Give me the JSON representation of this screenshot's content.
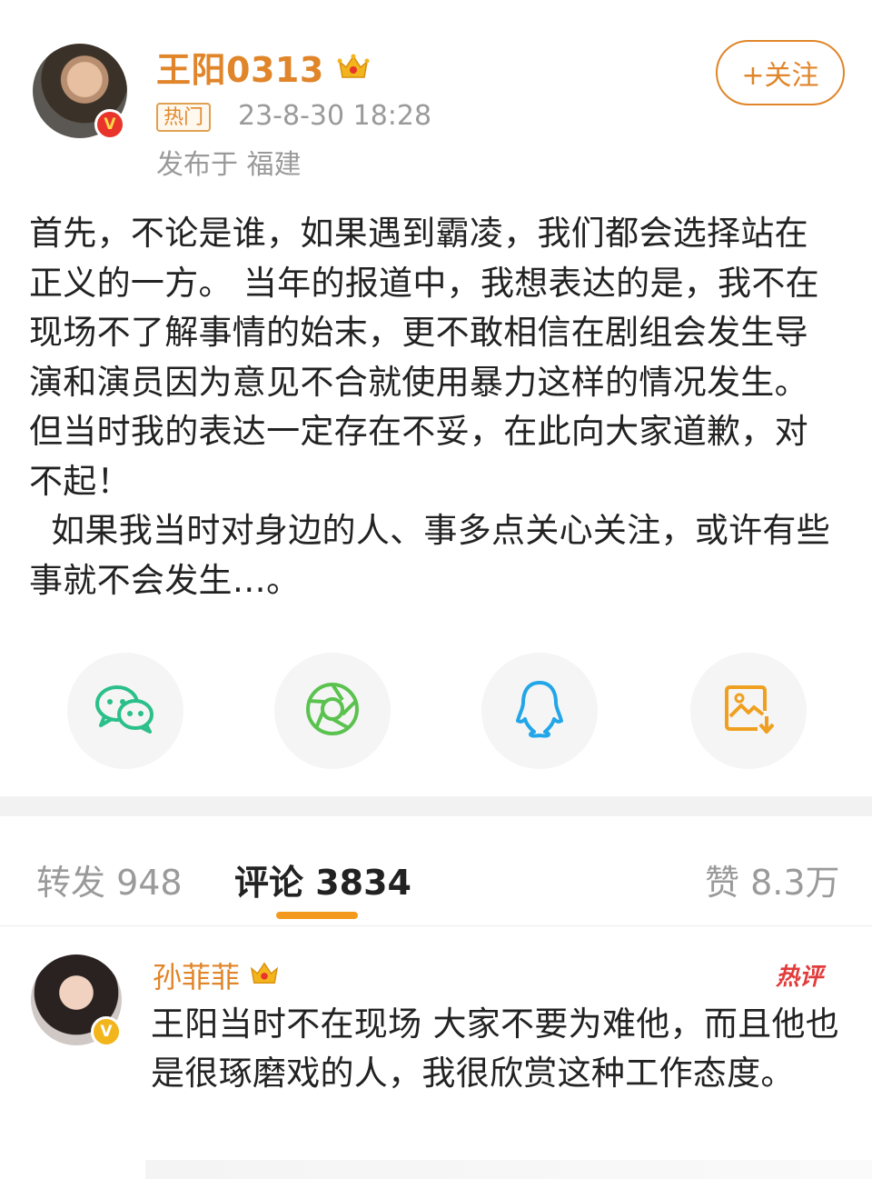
{
  "post": {
    "author": "王阳0313",
    "hot_tag": "热门",
    "time": "23-8-30 18:28",
    "location": "发布于 福建",
    "follow_label": "+关注",
    "body": "首先，不论是谁，如果遇到霸凌，我们都会选择站在正义的一方。 当年的报道中，我想表达的是，我不在现场不了解事情的始末，更不敢相信在剧组会发生导演和演员因为意见不合就使用暴力这样的情况发生。但当时我的表达一定存在不妥，在此向大家道歉，对不起！\n  如果我当时对身边的人、事多点关心关注，或许有些事就不会发生…。"
  },
  "share": [
    {
      "icon": "wechat-icon"
    },
    {
      "icon": "moments-icon"
    },
    {
      "icon": "qq-icon"
    },
    {
      "icon": "save-image-icon"
    }
  ],
  "tabs": {
    "repost": "转发 948",
    "comment": "评论 3834",
    "like": "赞 8.3万"
  },
  "comment": {
    "author": "孙菲菲",
    "badge": "热评",
    "text": "王阳当时不在现场 大家不要为难他，而且他也是很琢磨戏的人，我很欣赏这种工作态度。"
  },
  "colors": {
    "accent": "#e0852a",
    "tab_underline": "#f39a1e",
    "hot_comment": "#e23b3b",
    "verified_red": "#e8342a",
    "verified_gold": "#f2b51c"
  }
}
